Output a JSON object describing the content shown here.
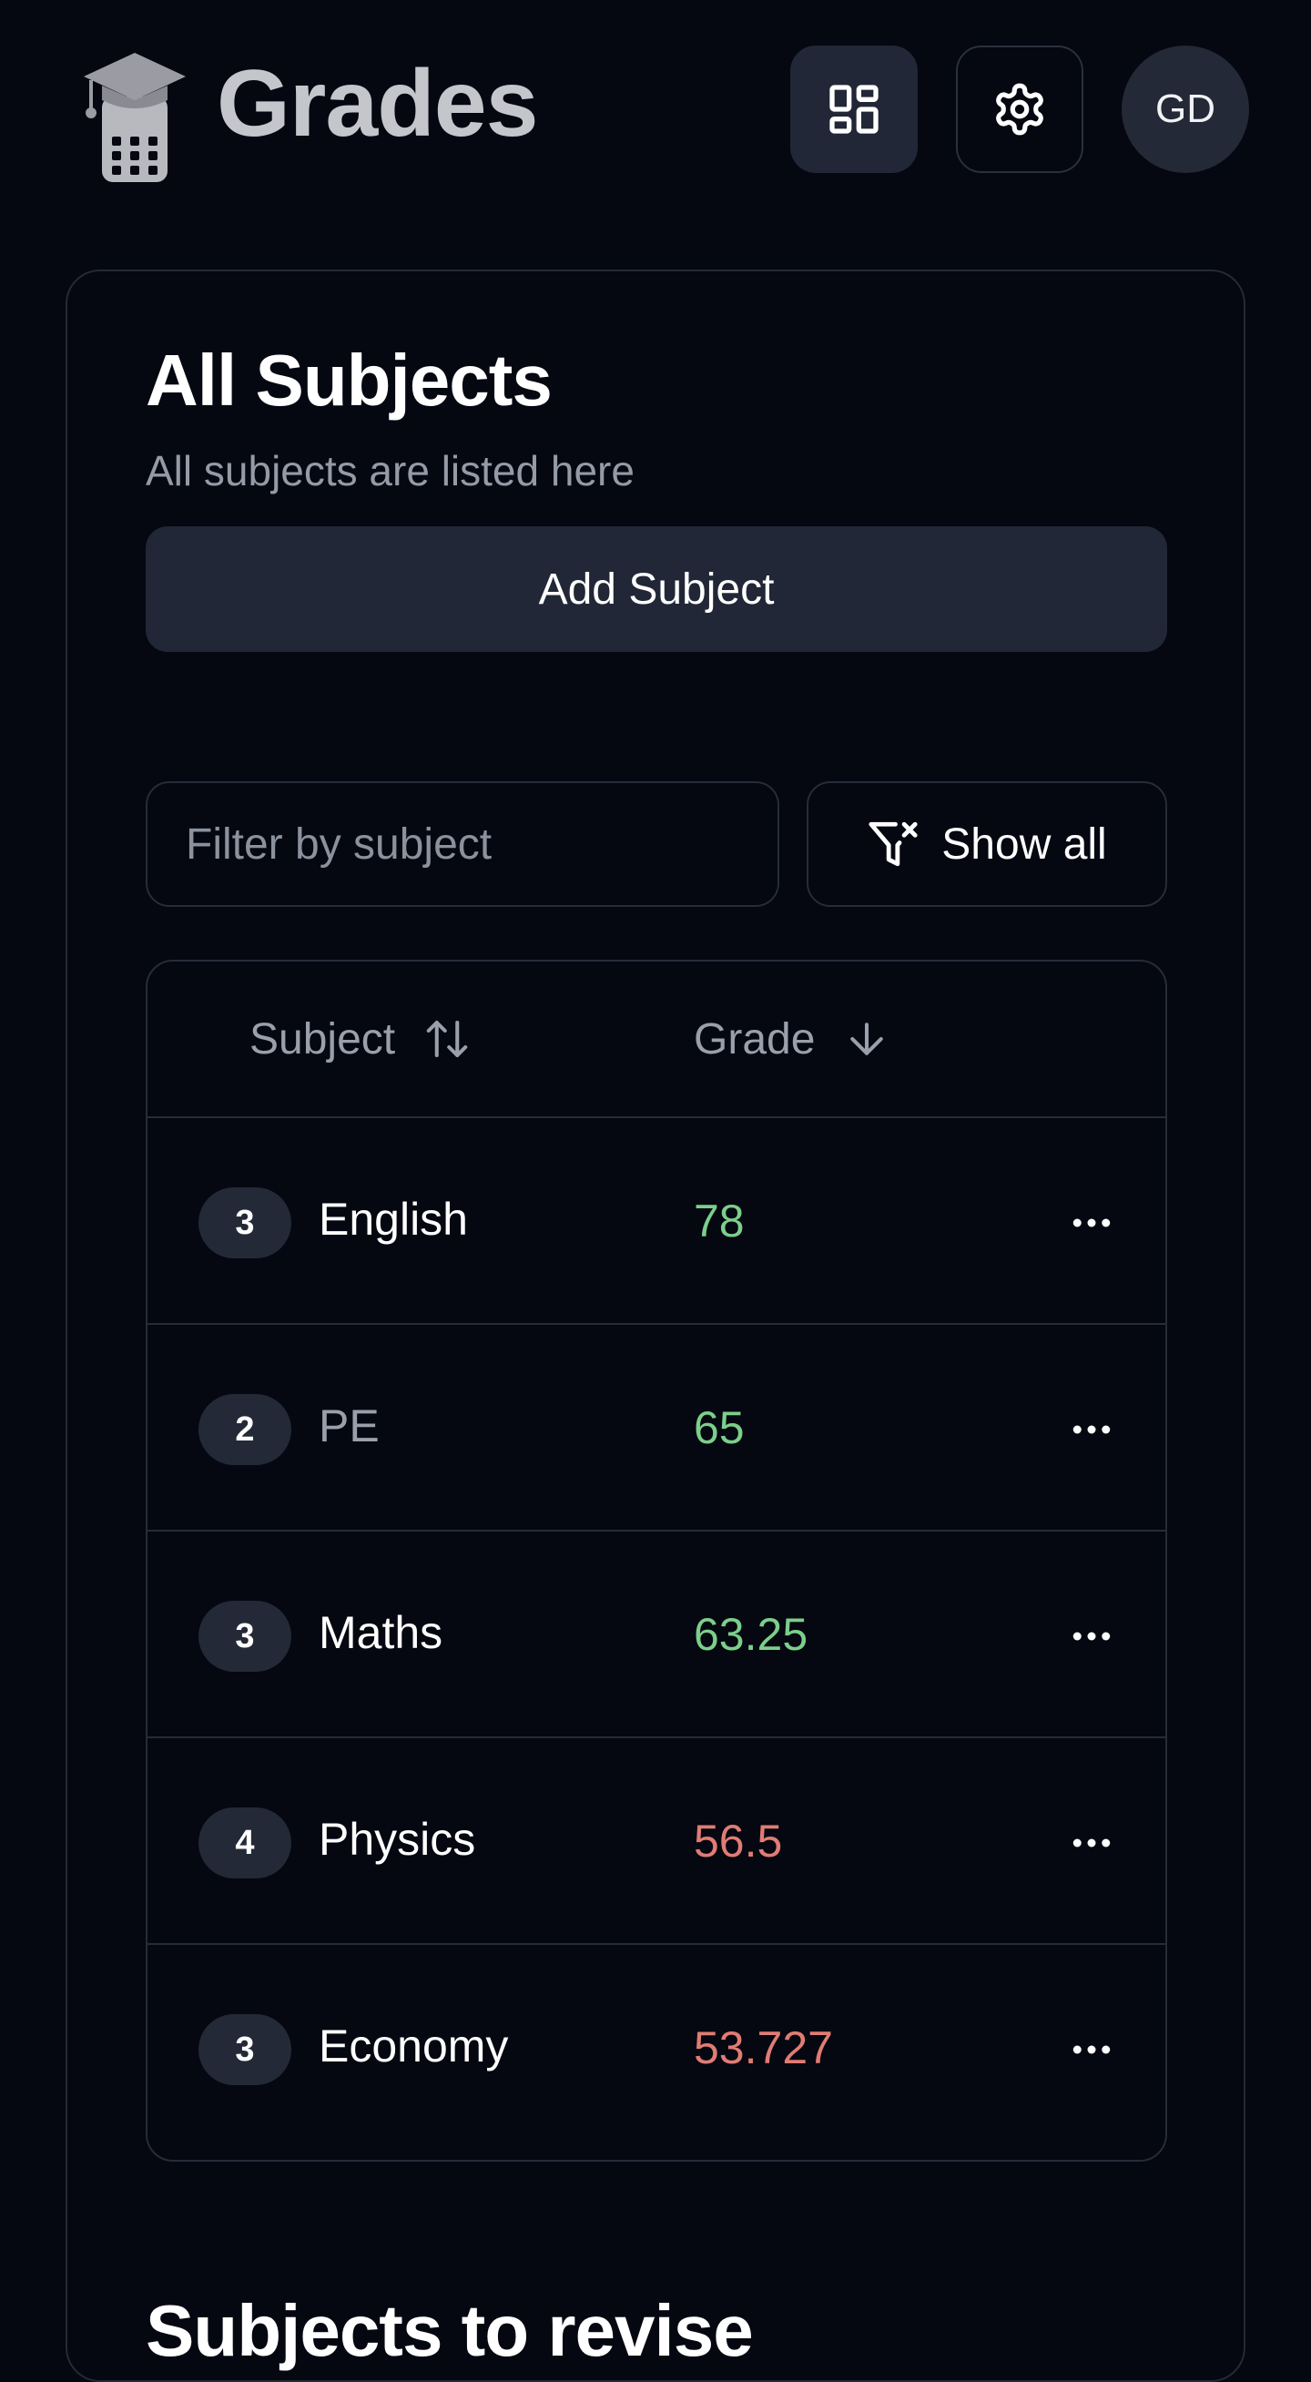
{
  "header": {
    "app_title": "Grades",
    "avatar_initials": "GD",
    "icons": {
      "logo": "graduation-cap-calculator-icon",
      "dashboard": "dashboard-grid-icon",
      "settings": "gear-icon"
    }
  },
  "card": {
    "title": "All Subjects",
    "subtitle": "All subjects are listed here",
    "add_button_label": "Add Subject"
  },
  "filter": {
    "placeholder": "Filter by subject",
    "value": "",
    "show_all_label": "Show all",
    "show_all_icon": "filter-x-icon"
  },
  "table": {
    "columns": [
      {
        "label": "Subject",
        "sort_icon": "sort-up-down-icon"
      },
      {
        "label": "Grade",
        "sort_icon": "arrow-down-icon"
      }
    ],
    "rows": [
      {
        "count": "3",
        "subject": "English",
        "grade": "78",
        "grade_status": "pass",
        "muted": false
      },
      {
        "count": "2",
        "subject": "PE",
        "grade": "65",
        "grade_status": "pass",
        "muted": true
      },
      {
        "count": "3",
        "subject": "Maths",
        "grade": "63.25",
        "grade_status": "pass",
        "muted": false
      },
      {
        "count": "4",
        "subject": "Physics",
        "grade": "56.5",
        "grade_status": "fail",
        "muted": false
      },
      {
        "count": "3",
        "subject": "Economy",
        "grade": "53.727",
        "grade_status": "fail",
        "muted": false
      }
    ],
    "row_action_icon": "more-horizontal-icon"
  },
  "next_section": {
    "title": "Subjects to revise"
  },
  "colors": {
    "background": "#050711",
    "surface": "#212736",
    "border": "#272c39",
    "grade_pass": "#7bcf8a",
    "grade_fail": "#e07c74",
    "muted_text": "#9aa0ab"
  }
}
